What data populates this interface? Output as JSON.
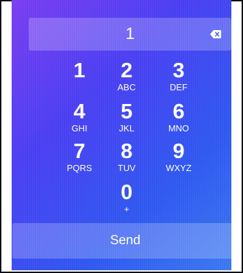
{
  "entry": {
    "value": "1",
    "backspace_icon": "backspace-icon"
  },
  "keypad": [
    {
      "digit": "1",
      "letters": ""
    },
    {
      "digit": "2",
      "letters": "ABC"
    },
    {
      "digit": "3",
      "letters": "DEF"
    },
    {
      "digit": "4",
      "letters": "GHI"
    },
    {
      "digit": "5",
      "letters": "JKL"
    },
    {
      "digit": "6",
      "letters": "MNO"
    },
    {
      "digit": "7",
      "letters": "PQRS"
    },
    {
      "digit": "8",
      "letters": "TUV"
    },
    {
      "digit": "9",
      "letters": "WXYZ"
    },
    {
      "digit": "0",
      "letters": "+"
    }
  ],
  "send_label": "Send",
  "colors": {
    "gradient_start": "#7a3cf0",
    "gradient_end": "#3a78f0",
    "panel": "rgba(255,255,255,0.22)"
  }
}
